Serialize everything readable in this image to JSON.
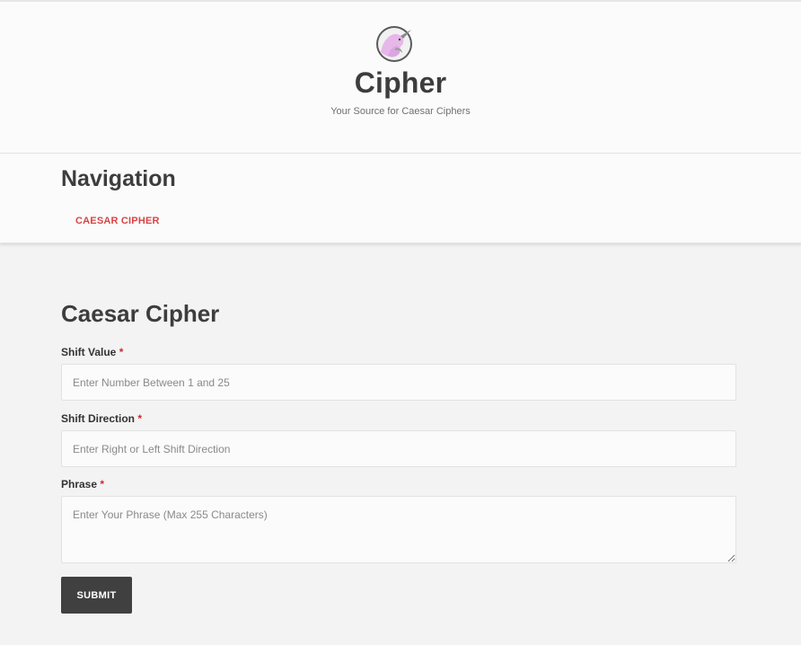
{
  "header": {
    "logo_icon": "unicorn-logo-icon",
    "title": "Cipher",
    "tagline": "Your Source for Caesar Ciphers"
  },
  "navigation": {
    "heading": "Navigation",
    "links": [
      {
        "label": "CAESAR CIPHER"
      }
    ],
    "link_color": "#d64545"
  },
  "form": {
    "title": "Caesar Cipher",
    "required_marker": "*",
    "fields": {
      "shift_value": {
        "label": "Shift Value",
        "value": "",
        "placeholder": "Enter Number Between 1 and 25"
      },
      "shift_direction": {
        "label": "Shift Direction",
        "value": "",
        "placeholder": "Enter Right or Left Shift Direction"
      },
      "phrase": {
        "label": "Phrase",
        "value": "",
        "placeholder": "Enter Your Phrase (Max 255 Characters)"
      }
    },
    "submit_label": "SUBMIT"
  },
  "colors": {
    "accent": "#d64545",
    "required": "#d02a2a",
    "button_bg": "#404040"
  }
}
